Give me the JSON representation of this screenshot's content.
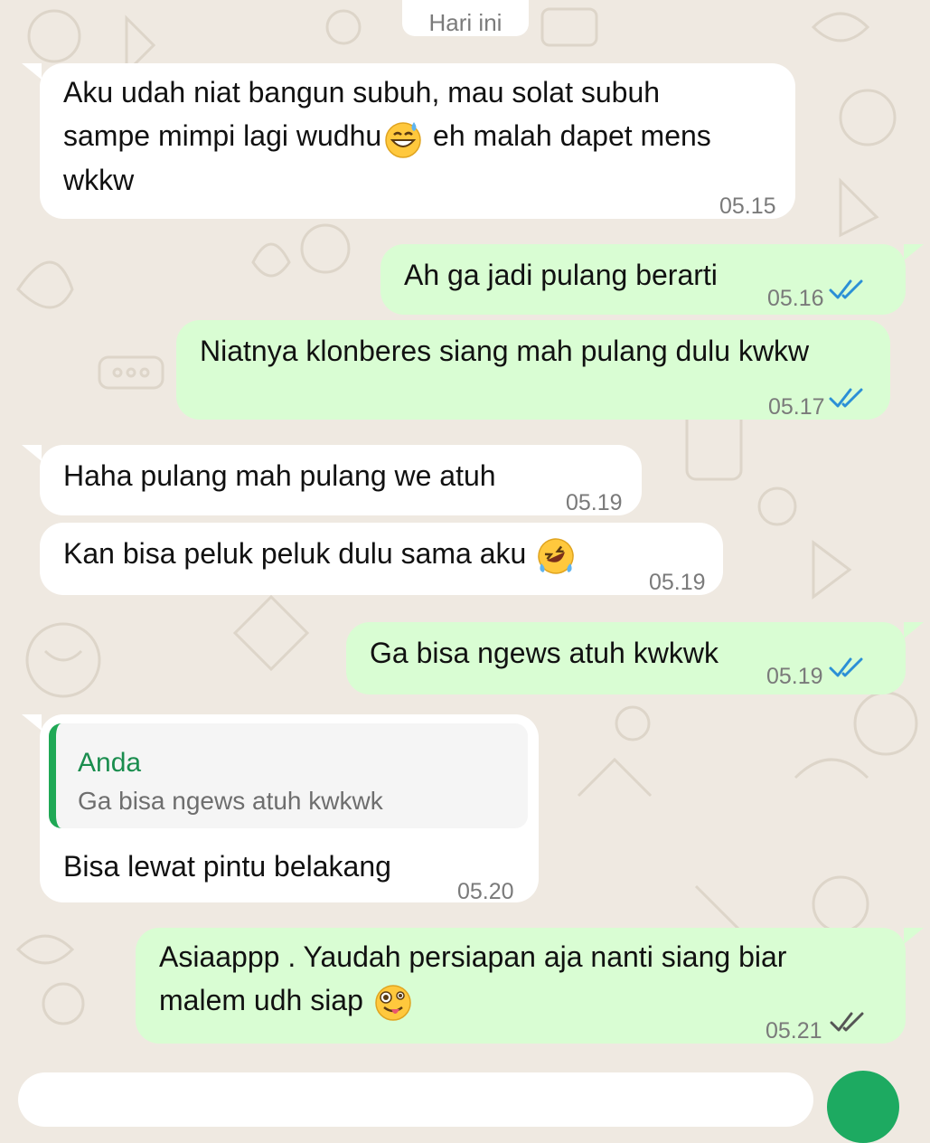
{
  "date_chip": "Hari ini",
  "colors": {
    "incoming_bubble": "#ffffff",
    "outgoing_bubble": "#d9fdd3",
    "read_tick": "#2b8fd6",
    "delivered_tick": "#555555",
    "quote_bar": "#1fa855",
    "quote_author": "#1a8d4e"
  },
  "messages": [
    {
      "direction": "in",
      "lines": [
        "Aku udah niat bangun subuh, mau solat subuh",
        "sampe mimpi lagi wudhu",
        "wkkw"
      ],
      "line2_suffix": "eh malah dapet mens",
      "emoji": "grinning-sweat-emoji",
      "time": "05.15"
    },
    {
      "direction": "out",
      "text": "Ah ga jadi pulang berarti",
      "time": "05.16",
      "status": "read"
    },
    {
      "direction": "out",
      "text": "Niatnya klonberes siang mah pulang dulu kwkw",
      "time": "05.17",
      "status": "read"
    },
    {
      "direction": "in",
      "text": "Haha pulang mah pulang we atuh",
      "time": "05.19"
    },
    {
      "direction": "in",
      "text": "Kan bisa peluk peluk dulu sama aku",
      "emoji": "rolling-laughing-emoji",
      "time": "05.19"
    },
    {
      "direction": "out",
      "text": "Ga bisa ngews atuh kwkwk",
      "time": "05.19",
      "status": "read"
    },
    {
      "direction": "in",
      "quote": {
        "author": "Anda",
        "text": "Ga bisa ngews atuh kwkwk"
      },
      "text": "Bisa lewat pintu belakang",
      "time": "05.20"
    },
    {
      "direction": "out",
      "lines": [
        "Asiaappp . Yaudah persiapan aja nanti siang biar",
        "malem udh siap"
      ],
      "emoji": "zany-face-emoji",
      "time": "05.21",
      "status": "delivered"
    }
  ]
}
